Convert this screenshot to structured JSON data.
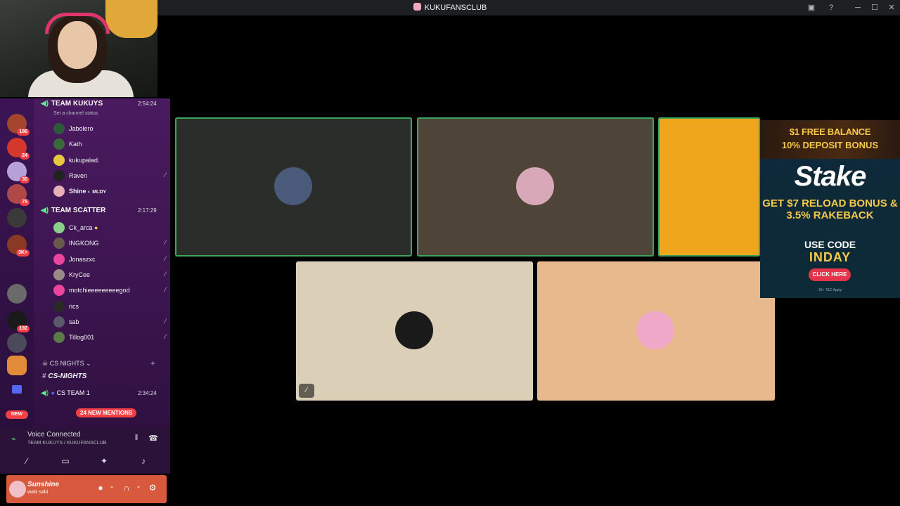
{
  "window": {
    "title": "KUKUFANSCLUB",
    "inbox_icon": "inbox-icon",
    "help_icon": "help-icon"
  },
  "servers": [
    {
      "badge": "186"
    },
    {
      "badge": "24"
    },
    {
      "badge": "35"
    },
    {
      "badge": "75"
    },
    {
      "badge": ""
    },
    {
      "badge": "3K+"
    },
    {
      "badge": ""
    },
    {
      "badge": "192"
    }
  ],
  "new_label": "NEW",
  "voice_channels": [
    {
      "name": "TEAM KUKUYS",
      "time": "2:54:24",
      "status_prompt": "Set a channel status",
      "members": [
        {
          "name": "Jabolero",
          "muted": false
        },
        {
          "name": "Kath",
          "muted": false
        },
        {
          "name": "kukupalad.",
          "muted": false
        },
        {
          "name": "Raven",
          "muted": true
        },
        {
          "name": "Shine",
          "tag": "MLDY",
          "muted": false
        }
      ]
    },
    {
      "name": "TEAM SCATTER",
      "time": "2:17:29",
      "members": [
        {
          "name": "Ck_arca",
          "muted": false
        },
        {
          "name": "INGKONG",
          "muted": true
        },
        {
          "name": "Jonaszxc",
          "muted": true
        },
        {
          "name": "KryCee",
          "muted": true
        },
        {
          "name": "motchieeeeeeeeegod",
          "muted": true
        },
        {
          "name": "rics",
          "muted": false
        },
        {
          "name": "sab",
          "muted": true
        },
        {
          "name": "Tillog001",
          "muted": true
        }
      ]
    }
  ],
  "category": {
    "name": "CS NIGHTS"
  },
  "text_channel": {
    "name": "CS-NIGHTS"
  },
  "cs_team": {
    "name": "CS TEAM 1",
    "time": "2:34:24"
  },
  "mentions_pill": "24 NEW MENTIONS",
  "voice_panel": {
    "title": "Voice Connected",
    "location": "TEAM KUKUYS / KUKUFANSCLUB"
  },
  "user": {
    "name": "Sunshine",
    "status": "wabi sabi"
  },
  "tiles": [
    {
      "bg": "#2b2d2b",
      "speaking": true,
      "avatar_color": "#4a5a7a"
    },
    {
      "bg": "#4f4438",
      "speaking": true,
      "avatar_color": "#d8a8b8"
    },
    {
      "bg": "#f0a61c",
      "speaking": true,
      "avatar_color": "#f0a61c"
    },
    {
      "bg": "#dccfb8",
      "speaking": false,
      "avatar_color": "#1a1a1a",
      "mic_off": true
    },
    {
      "bg": "#e9b98e",
      "speaking": false,
      "avatar_color": "#f0a8c8"
    }
  ],
  "ad": {
    "line1_highlight": "$1",
    "line1_rest": " FREE BALANCE",
    "line2": "10% DEPOSIT BONUS",
    "brand": "Stake",
    "promo": "GET $7 RELOAD BONUS & 3.5% RAKEBACK",
    "use_code": "USE CODE",
    "code": "INDAY",
    "cta": "CLICK HERE",
    "fine": "18+ T&C Apply"
  }
}
